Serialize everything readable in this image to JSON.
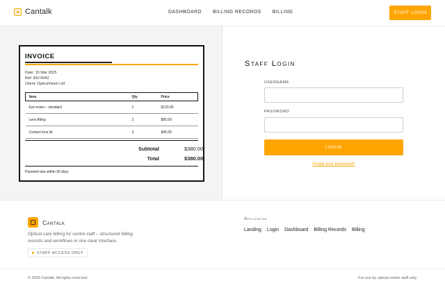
{
  "header": {
    "brand": "Cantalk",
    "nav": [
      "Dashboard",
      "Billing Records",
      "Billing"
    ],
    "staff_login": "Staff Login"
  },
  "invoice": {
    "title": "INVOICE",
    "date": "Date: 15 Mar 2025",
    "ref": "Ref: INV-0042",
    "client": "Client: OpticaVision Ltd",
    "columns": [
      "Item",
      "Qty",
      "Price"
    ],
    "rows": [
      {
        "item": "Eye exam – standard",
        "qty": "1",
        "price": "$120.00"
      },
      {
        "item": "Lens fitting",
        "qty": "2",
        "price": "$85.00"
      },
      {
        "item": "Contact lens kit",
        "qty": "3",
        "price": "$45.00"
      }
    ],
    "subtotal_label": "Subtotal",
    "subtotal": "$380.00",
    "total_label": "Total",
    "total": "$380.00",
    "footer": "Payment due within 30 days"
  },
  "login": {
    "title": "Staff Login",
    "username_label": "Username",
    "username_value": "",
    "password_label": "Password",
    "password_value": "",
    "button": "Login",
    "forgot": "Forgot your password?"
  },
  "footer": {
    "brand": "Cantalk",
    "description": "Optical care billing for centre staff – structured billing records and workflows in one clear interface.",
    "badge": "Staff access only",
    "app_label": "Application",
    "links": [
      "Landing",
      "Login",
      "Dashboard",
      "Billing Records",
      "Billing"
    ],
    "copyright": "© 2026 Cantalk. All rights reserved.",
    "note": "For use by optical centre staff only."
  },
  "colors": {
    "accent": "#ffa500",
    "panel_bg": "#f4f4f4"
  },
  "icons": {
    "brand": "logo-square-icon",
    "badge": "dot-icon"
  }
}
